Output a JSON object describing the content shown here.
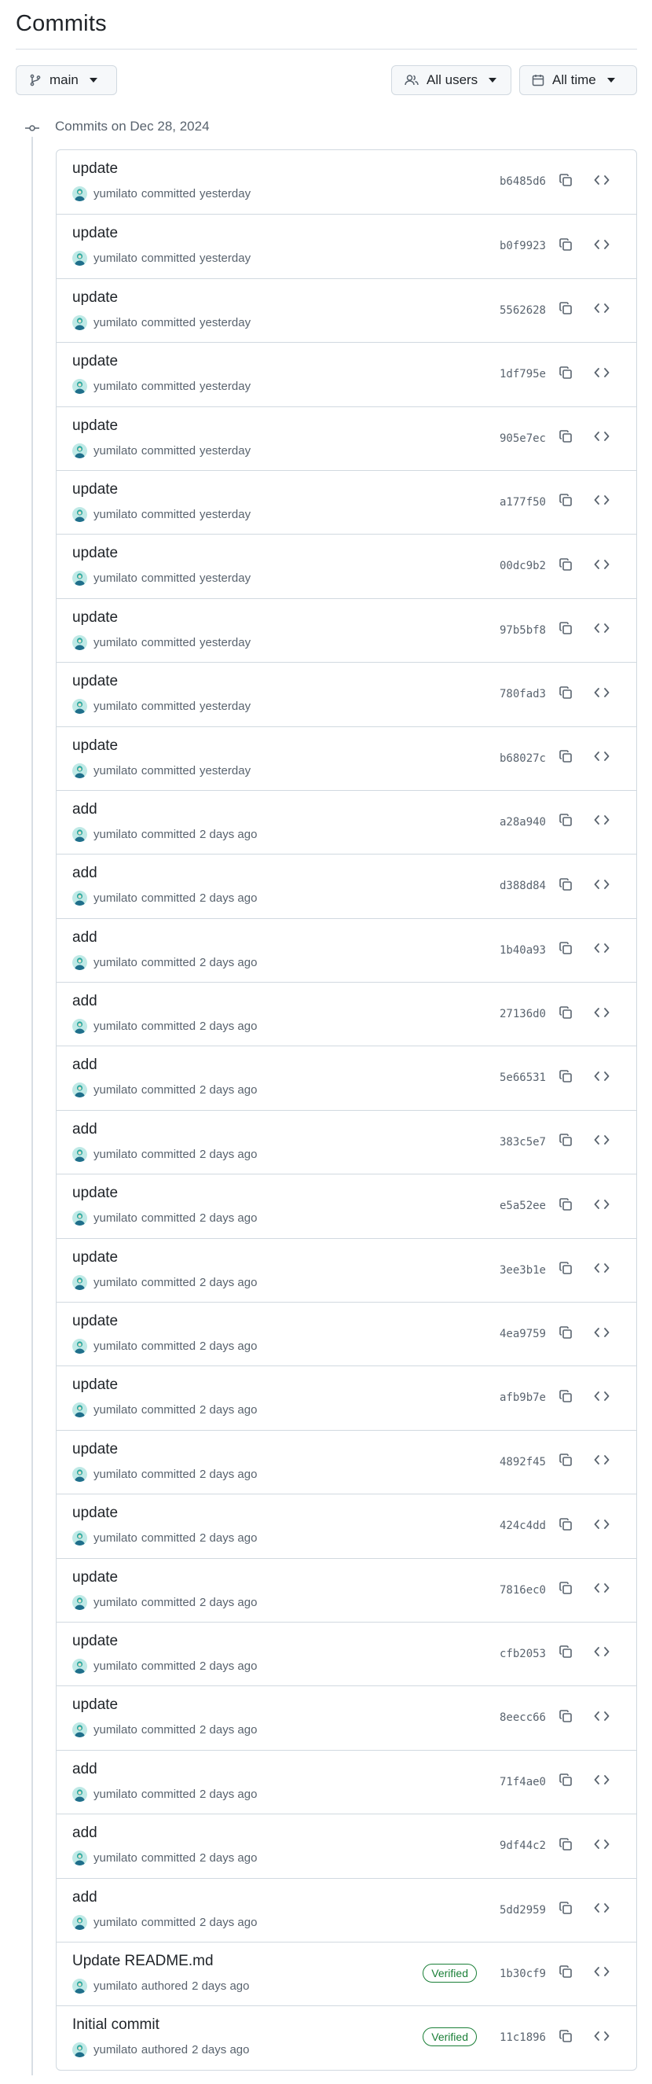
{
  "page": {
    "title": "Commits"
  },
  "toolbar": {
    "branch_label": "main",
    "users_label": "All users",
    "time_label": "All time"
  },
  "group": {
    "label": "Commits on Dec 28, 2024"
  },
  "colors": {
    "border": "#d1d9e0",
    "text_primary": "#1f2328",
    "text_muted": "#59636e",
    "verified_green": "#1a7f37",
    "button_bg": "#f6f8fa"
  },
  "icons": {
    "branch": "git-branch-icon",
    "users": "people-icon",
    "time": "calendar-icon",
    "caret": "triangle-down-icon",
    "commit_node": "git-commit-icon",
    "copy": "copy-icon",
    "browse": "code-icon"
  },
  "commits": [
    {
      "message": "update",
      "author": "yumilato",
      "action": "committed",
      "time": "yesterday",
      "sha": "b6485d6",
      "verified": false
    },
    {
      "message": "update",
      "author": "yumilato",
      "action": "committed",
      "time": "yesterday",
      "sha": "b0f9923",
      "verified": false
    },
    {
      "message": "update",
      "author": "yumilato",
      "action": "committed",
      "time": "yesterday",
      "sha": "5562628",
      "verified": false
    },
    {
      "message": "update",
      "author": "yumilato",
      "action": "committed",
      "time": "yesterday",
      "sha": "1df795e",
      "verified": false
    },
    {
      "message": "update",
      "author": "yumilato",
      "action": "committed",
      "time": "yesterday",
      "sha": "905e7ec",
      "verified": false
    },
    {
      "message": "update",
      "author": "yumilato",
      "action": "committed",
      "time": "yesterday",
      "sha": "a177f50",
      "verified": false
    },
    {
      "message": "update",
      "author": "yumilato",
      "action": "committed",
      "time": "yesterday",
      "sha": "00dc9b2",
      "verified": false
    },
    {
      "message": "update",
      "author": "yumilato",
      "action": "committed",
      "time": "yesterday",
      "sha": "97b5bf8",
      "verified": false
    },
    {
      "message": "update",
      "author": "yumilato",
      "action": "committed",
      "time": "yesterday",
      "sha": "780fad3",
      "verified": false
    },
    {
      "message": "update",
      "author": "yumilato",
      "action": "committed",
      "time": "yesterday",
      "sha": "b68027c",
      "verified": false
    },
    {
      "message": "add",
      "author": "yumilato",
      "action": "committed",
      "time": "2 days ago",
      "sha": "a28a940",
      "verified": false
    },
    {
      "message": "add",
      "author": "yumilato",
      "action": "committed",
      "time": "2 days ago",
      "sha": "d388d84",
      "verified": false
    },
    {
      "message": "add",
      "author": "yumilato",
      "action": "committed",
      "time": "2 days ago",
      "sha": "1b40a93",
      "verified": false
    },
    {
      "message": "add",
      "author": "yumilato",
      "action": "committed",
      "time": "2 days ago",
      "sha": "27136d0",
      "verified": false
    },
    {
      "message": "add",
      "author": "yumilato",
      "action": "committed",
      "time": "2 days ago",
      "sha": "5e66531",
      "verified": false
    },
    {
      "message": "add",
      "author": "yumilato",
      "action": "committed",
      "time": "2 days ago",
      "sha": "383c5e7",
      "verified": false
    },
    {
      "message": "update",
      "author": "yumilato",
      "action": "committed",
      "time": "2 days ago",
      "sha": "e5a52ee",
      "verified": false
    },
    {
      "message": "update",
      "author": "yumilato",
      "action": "committed",
      "time": "2 days ago",
      "sha": "3ee3b1e",
      "verified": false
    },
    {
      "message": "update",
      "author": "yumilato",
      "action": "committed",
      "time": "2 days ago",
      "sha": "4ea9759",
      "verified": false
    },
    {
      "message": "update",
      "author": "yumilato",
      "action": "committed",
      "time": "2 days ago",
      "sha": "afb9b7e",
      "verified": false
    },
    {
      "message": "update",
      "author": "yumilato",
      "action": "committed",
      "time": "2 days ago",
      "sha": "4892f45",
      "verified": false
    },
    {
      "message": "update",
      "author": "yumilato",
      "action": "committed",
      "time": "2 days ago",
      "sha": "424c4dd",
      "verified": false
    },
    {
      "message": "update",
      "author": "yumilato",
      "action": "committed",
      "time": "2 days ago",
      "sha": "7816ec0",
      "verified": false
    },
    {
      "message": "update",
      "author": "yumilato",
      "action": "committed",
      "time": "2 days ago",
      "sha": "cfb2053",
      "verified": false
    },
    {
      "message": "update",
      "author": "yumilato",
      "action": "committed",
      "time": "2 days ago",
      "sha": "8eecc66",
      "verified": false
    },
    {
      "message": "add",
      "author": "yumilato",
      "action": "committed",
      "time": "2 days ago",
      "sha": "71f4ae0",
      "verified": false
    },
    {
      "message": "add",
      "author": "yumilato",
      "action": "committed",
      "time": "2 days ago",
      "sha": "9df44c2",
      "verified": false
    },
    {
      "message": "add",
      "author": "yumilato",
      "action": "committed",
      "time": "2 days ago",
      "sha": "5dd2959",
      "verified": false
    },
    {
      "message": "Update README.md",
      "author": "yumilato",
      "action": "authored",
      "time": "2 days ago",
      "sha": "1b30cf9",
      "verified": true,
      "verified_label": "Verified"
    },
    {
      "message": "Initial commit",
      "author": "yumilato",
      "action": "authored",
      "time": "2 days ago",
      "sha": "11c1896",
      "verified": true,
      "verified_label": "Verified"
    }
  ]
}
